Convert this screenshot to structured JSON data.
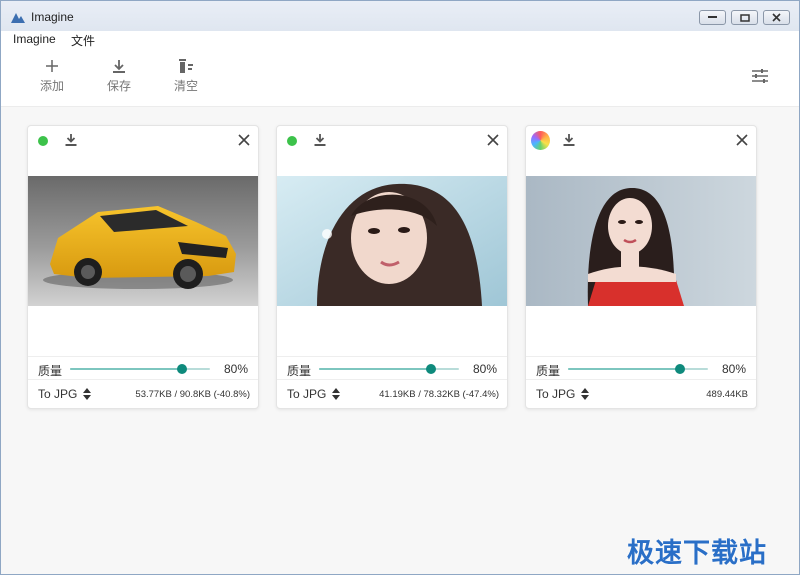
{
  "window": {
    "title": "Imagine"
  },
  "menu": {
    "items": [
      "Imagine",
      "文件"
    ]
  },
  "toolbar": {
    "add_label": "添加",
    "save_label": "保存",
    "clear_label": "清空"
  },
  "colors": {
    "accent": "#0e8a7c",
    "status_done": "#3cc24a",
    "watermark": "#2a6fc7"
  },
  "cards": [
    {
      "status": "done",
      "status_icon": "green-dot-icon",
      "image_subject": "yellow sports SUV",
      "quality_label": "质量",
      "quality_value": "80%",
      "quality_fraction": 0.8,
      "format": "To JPG",
      "size_info": "53.77KB / 90.8KB (-40.8%)"
    },
    {
      "status": "done",
      "status_icon": "green-dot-icon",
      "image_subject": "portrait of a woman",
      "quality_label": "质量",
      "quality_value": "80%",
      "quality_fraction": 0.8,
      "format": "To JPG",
      "size_info": "41.19KB / 78.32KB (-47.4%)"
    },
    {
      "status": "processing",
      "status_icon": "color-wheel-icon",
      "image_subject": "woman in red dress",
      "quality_label": "质量",
      "quality_value": "80%",
      "quality_fraction": 0.8,
      "format": "To JPG",
      "size_info": "489.44KB"
    }
  ],
  "watermark": "极速下载站"
}
